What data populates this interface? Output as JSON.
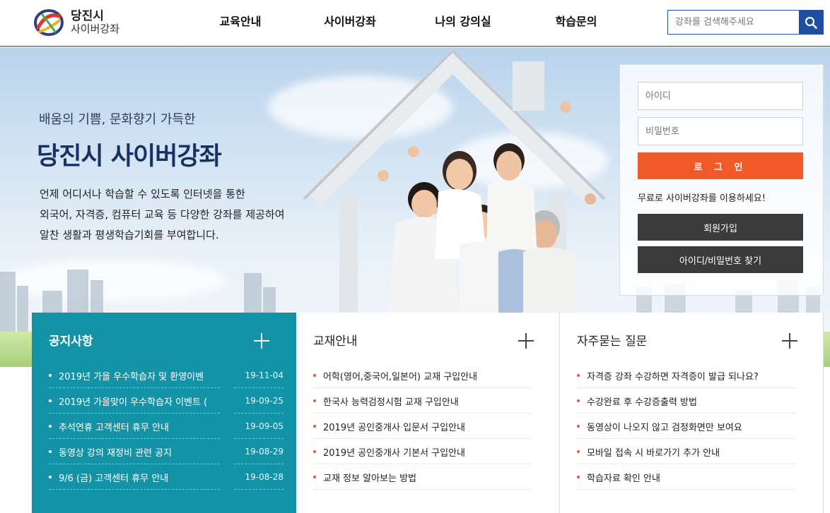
{
  "header": {
    "logo_line1": "당진시",
    "logo_line2": "사이버강좌",
    "nav": [
      "교육안내",
      "사이버강좌",
      "나의 강의실",
      "학습문의"
    ],
    "search_placeholder": "강좌를 검색해주세요"
  },
  "hero": {
    "subtitle": "배움의 기쁨, 문화향기 가득한",
    "title": "당진시 사이버강좌",
    "desc": [
      "언제 어디서나 학습할 수 있도록 인터넷을 통한",
      "외국어, 자격증, 컴퓨터 교육 등 다양한 강좌를 제공하여",
      "알찬 생활과 평생학습기회를 부여합니다."
    ]
  },
  "login": {
    "id_placeholder": "아이디",
    "pw_placeholder": "비밀번호",
    "login_label": "로 그 인",
    "message": "무료로 사이버강좌를 이용하세요!",
    "join_label": "회원가입",
    "find_label": "아이디/비밀번호 찾기"
  },
  "notice": {
    "title": "공지사항",
    "items": [
      {
        "title": "2019년 가을 우수학습자 및 환영이벤",
        "date": "19-11-04"
      },
      {
        "title": "2019년 가을맞이 우수학습자 이벤트 (",
        "date": "19-09-25"
      },
      {
        "title": "추석연휴 고객센터 휴무 안내",
        "date": "19-09-05"
      },
      {
        "title": "동영상 강의 재정비 관련 공지",
        "date": "19-08-29"
      },
      {
        "title": "9/6 (금) 고객센터 휴무 안내",
        "date": "19-08-28"
      }
    ]
  },
  "textbook": {
    "title": "교재안내",
    "items": [
      "어학(영어,중국어,일본어) 교재 구입안내",
      "한국사 능력검정시험 교재 구입안내",
      "2019년 공인중개사 입문서 구입안내",
      "2019년 공인중개사 기본서 구입안내",
      "교재 정보 알아보는 방법"
    ]
  },
  "faq": {
    "title": "자주묻는 질문",
    "items": [
      "자격증 강좌 수강하면 자격증이 발급 되나요?",
      "수강완료 후 수강증출력 방법",
      "동영상이 나오지 않고 검정화면만 보여요",
      "모바일 접속 시 바로가기 추가 안내",
      "학습자료 확인 안내"
    ]
  },
  "colors": {
    "accent": "#f05a28",
    "notice_bg": "#1593a6",
    "dark_button": "#3b3b3b",
    "search_button": "#1e4f9e",
    "title_navy": "#173160"
  }
}
